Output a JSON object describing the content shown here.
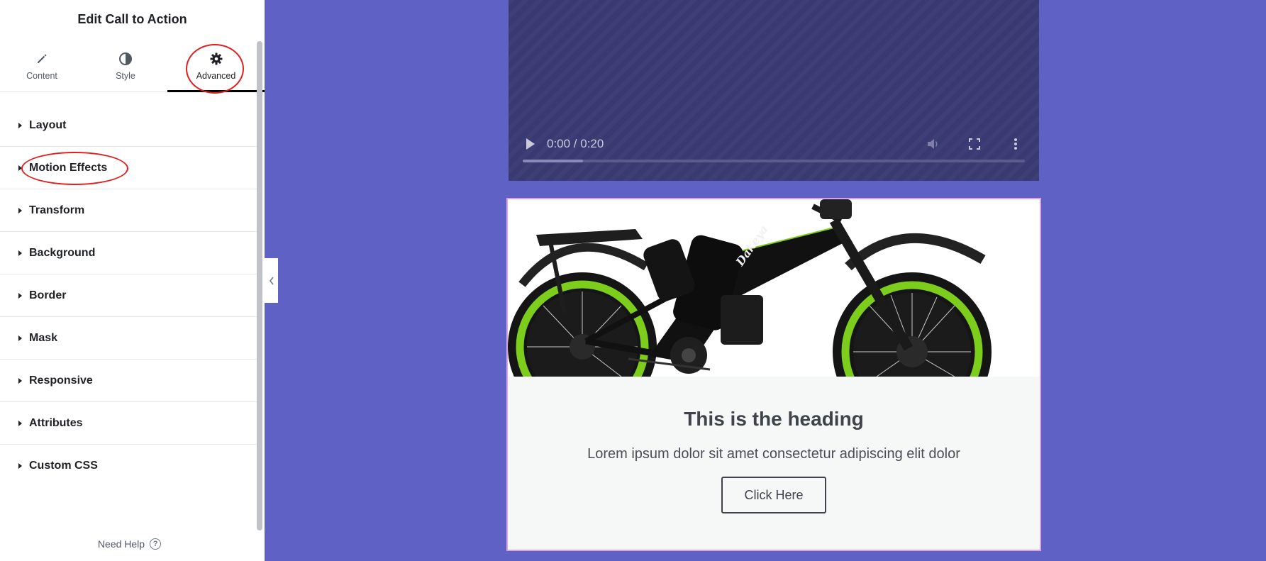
{
  "panel": {
    "title": "Edit Call to Action",
    "tabs": [
      {
        "label": "Content",
        "icon": "pencil-icon",
        "active": false
      },
      {
        "label": "Style",
        "icon": "contrast-icon",
        "active": false
      },
      {
        "label": "Advanced",
        "icon": "gear-icon",
        "active": true
      }
    ],
    "sections": [
      {
        "label": "Layout"
      },
      {
        "label": "Motion Effects"
      },
      {
        "label": "Transform"
      },
      {
        "label": "Background"
      },
      {
        "label": "Border"
      },
      {
        "label": "Mask"
      },
      {
        "label": "Responsive"
      },
      {
        "label": "Attributes"
      },
      {
        "label": "Custom CSS"
      }
    ],
    "help_label": "Need Help",
    "help_icon": "?"
  },
  "video": {
    "time": "0:00 / 0:20",
    "progress": 0.12
  },
  "cta": {
    "image_text": "Dakeya",
    "heading": "This is the heading",
    "description": "Lorem ipsum dolor sit amet consectetur adipiscing elit dolor",
    "button_label": "Click Here"
  },
  "colors": {
    "canvas_bg": "#6061c4",
    "video_bg": "#3a3a73",
    "annotation": "#e21d1d",
    "cta_border": "#d9a3e6",
    "bike_accent": "#7ccd1c"
  }
}
